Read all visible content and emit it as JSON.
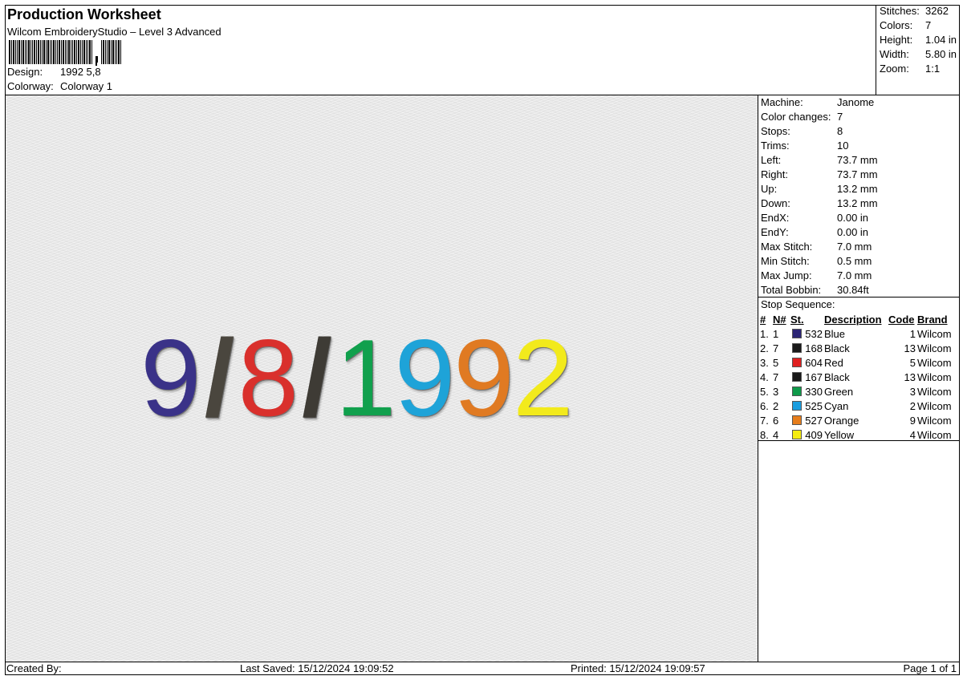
{
  "header": {
    "title": "Production Worksheet",
    "subtitle": "Wilcom EmbroideryStudio – Level 3 Advanced",
    "design_label": "Design:",
    "design_value": "1992 5,8",
    "colorway_label": "Colorway:",
    "colorway_value": "Colorway 1"
  },
  "summary": {
    "stitches_label": "Stitches:",
    "stitches": "3262",
    "colors_label": "Colors:",
    "colors": "7",
    "height_label": "Height:",
    "height": "1.04 in",
    "width_label": "Width:",
    "width": "5.80 in",
    "zoom_label": "Zoom:",
    "zoom": "1:1"
  },
  "machine": [
    {
      "label": "Machine:",
      "value": "Janome"
    },
    {
      "label": "Color changes:",
      "value": "7"
    },
    {
      "label": "Stops:",
      "value": "8"
    },
    {
      "label": "Trims:",
      "value": "10"
    },
    {
      "label": "Left:",
      "value": "73.7 mm"
    },
    {
      "label": "Right:",
      "value": "73.7 mm"
    },
    {
      "label": "Up:",
      "value": "13.2 mm"
    },
    {
      "label": "Down:",
      "value": "13.2 mm"
    },
    {
      "label": "EndX:",
      "value": "0.00 in"
    },
    {
      "label": "EndY:",
      "value": "0.00 in"
    },
    {
      "label": "Max Stitch:",
      "value": "7.0 mm"
    },
    {
      "label": "Min Stitch:",
      "value": "0.5 mm"
    },
    {
      "label": "Max Jump:",
      "value": "7.0 mm"
    },
    {
      "label": "Total Bobbin:",
      "value": "30.84ft"
    }
  ],
  "stop_sequence": {
    "title": "Stop Sequence:",
    "headers": {
      "num": "#",
      "n": "N#",
      "st": "St.",
      "desc": "Description",
      "code": "Code",
      "brand": "Brand"
    },
    "rows": [
      {
        "num": "1.",
        "n": "1",
        "color": "#2b2475",
        "st": "532",
        "desc": "Blue",
        "code": "1",
        "brand": "Wilcom"
      },
      {
        "num": "2.",
        "n": "7",
        "color": "#1a1a1a",
        "st": "168",
        "desc": "Black",
        "code": "13",
        "brand": "Wilcom"
      },
      {
        "num": "3.",
        "n": "5",
        "color": "#e02020",
        "st": "604",
        "desc": "Red",
        "code": "5",
        "brand": "Wilcom"
      },
      {
        "num": "4.",
        "n": "7",
        "color": "#1a1a1a",
        "st": "167",
        "desc": "Black",
        "code": "13",
        "brand": "Wilcom"
      },
      {
        "num": "5.",
        "n": "3",
        "color": "#0f9a4a",
        "st": "330",
        "desc": "Green",
        "code": "3",
        "brand": "Wilcom"
      },
      {
        "num": "6.",
        "n": "2",
        "color": "#1a9ee0",
        "st": "525",
        "desc": "Cyan",
        "code": "2",
        "brand": "Wilcom"
      },
      {
        "num": "7.",
        "n": "6",
        "color": "#e67d1c",
        "st": "527",
        "desc": "Orange",
        "code": "9",
        "brand": "Wilcom"
      },
      {
        "num": "8.",
        "n": "4",
        "color": "#f5ec10",
        "st": "409",
        "desc": "Yellow",
        "code": "4",
        "brand": "Wilcom"
      }
    ]
  },
  "design_glyphs": [
    {
      "char": "9",
      "color": "#3a3288"
    },
    {
      "char": "/",
      "color": "#4a463e"
    },
    {
      "char": "8",
      "color": "#d9302c"
    },
    {
      "char": "/",
      "color": "#3e3b35"
    },
    {
      "char": "1",
      "color": "#11a04d"
    },
    {
      "char": "9",
      "color": "#1ea3d8"
    },
    {
      "char": "9",
      "color": "#e07a22"
    },
    {
      "char": "2",
      "color": "#f2ea1c"
    }
  ],
  "footer": {
    "created_by": "Created By:",
    "last_saved": "Last Saved: 15/12/2024 19:09:52",
    "printed": "Printed: 15/12/2024 19:09:57",
    "page": "Page 1 of 1"
  }
}
